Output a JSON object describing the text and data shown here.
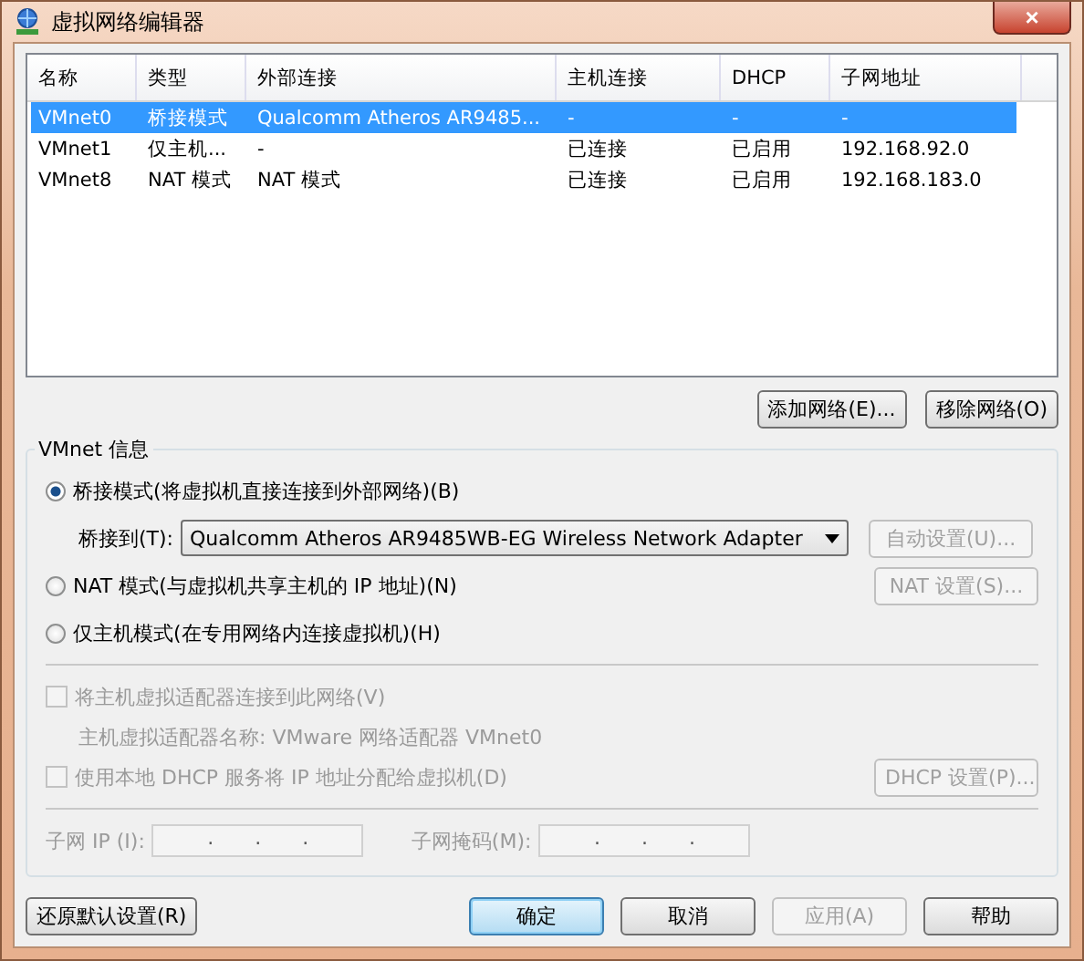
{
  "window": {
    "title": "虚拟网络编辑器",
    "close": "×"
  },
  "table": {
    "columns": [
      "名称",
      "类型",
      "外部连接",
      "主机连接",
      "DHCP",
      "子网地址"
    ],
    "rows": [
      {
        "cells": [
          "VMnet0",
          "桥接模式",
          "Qualcomm Atheros AR9485...",
          "-",
          "-",
          "-"
        ],
        "selected": true
      },
      {
        "cells": [
          "VMnet1",
          "仅主机...",
          "-",
          "已连接",
          "已启用",
          "192.168.92.0"
        ],
        "selected": false
      },
      {
        "cells": [
          "VMnet8",
          "NAT 模式",
          "NAT 模式",
          "已连接",
          "已启用",
          "192.168.183.0"
        ],
        "selected": false
      }
    ]
  },
  "table_buttons": [
    {
      "label": "添加网络(E)...",
      "disabled": false
    },
    {
      "label": "移除网络(O)",
      "disabled": false
    }
  ],
  "group": {
    "title": "VMnet 信息",
    "modes": [
      {
        "label": "桥接模式(将虚拟机直接连接到外部网络)(B)",
        "selected": true
      },
      {
        "label": "NAT 模式(与虚拟机共享主机的 IP 地址)(N)",
        "selected": false
      },
      {
        "label": "仅主机模式(在专用网络内连接虚拟机)(H)",
        "selected": false
      }
    ],
    "bridge_label": "桥接到(T):",
    "bridge_value": "Qualcomm Atheros AR9485WB-EG Wireless Network Adapter",
    "auto_button": {
      "label": "自动设置(U)...",
      "disabled": true
    },
    "nat_button": {
      "label": "NAT 设置(S)...",
      "disabled": true
    },
    "connect_adapter": {
      "label": "将主机虚拟适配器连接到此网络(V)",
      "checked": false,
      "disabled": true
    },
    "adapter_name": "主机虚拟适配器名称: VMware 网络适配器 VMnet0",
    "use_dhcp": {
      "label": "使用本地 DHCP 服务将 IP 地址分配给虚拟机(D)",
      "checked": false,
      "disabled": true
    },
    "dhcp_button": {
      "label": "DHCP 设置(P)...",
      "disabled": true
    },
    "ip_fields": [
      {
        "label": "子网 IP (I):",
        "separators": [
          ".",
          ".",
          "."
        ]
      },
      {
        "label": "子网掩码(M):",
        "separators": [
          ".",
          ".",
          "."
        ]
      }
    ]
  },
  "footer": {
    "restore": {
      "label": "还原默认设置(R)",
      "disabled": false
    },
    "buttons": [
      {
        "label": "确定",
        "disabled": false,
        "default": true
      },
      {
        "label": "取消",
        "disabled": false,
        "default": false
      },
      {
        "label": "应用(A)",
        "disabled": true,
        "default": false
      },
      {
        "label": "帮助",
        "disabled": false,
        "default": false
      }
    ]
  }
}
